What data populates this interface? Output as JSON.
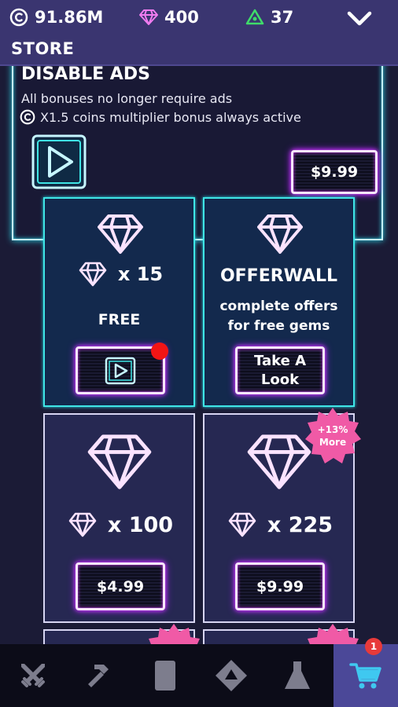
{
  "header": {
    "coins": "91.86M",
    "gems": "400",
    "tokens": "37",
    "title": "STORE"
  },
  "ads_offer": {
    "title": "DISABLE ADS",
    "line1": "All bonuses no longer require ads",
    "line2": "X1.5 coins multiplier bonus always active",
    "price": "$9.99"
  },
  "free_gems": {
    "quantity": "x 15",
    "label": "FREE"
  },
  "offerwall": {
    "title": "OFFERWALL",
    "desc_line1": "complete offers",
    "desc_line2": "for free gems",
    "button_line1": "Take A",
    "button_line2": "Look"
  },
  "gem_packs": [
    {
      "quantity": "x 100",
      "price": "$4.99"
    },
    {
      "quantity": "x 225",
      "price": "$9.99",
      "bonus_line1": "+13%",
      "bonus_line2": "More"
    }
  ],
  "nav": {
    "items": [
      "crossed-swords-icon",
      "hammer-icon",
      "card-icon",
      "diamond-shape-icon",
      "flask-icon",
      "cart-icon"
    ],
    "active": "cart-icon",
    "cart_badge": "1"
  },
  "colors": {
    "cyan_glow": "#3fe6e6",
    "purple_glow": "#d63cff",
    "gem_pink": "#f07cf0",
    "badge_red": "#f21515",
    "header_bg": "#3a3570"
  }
}
